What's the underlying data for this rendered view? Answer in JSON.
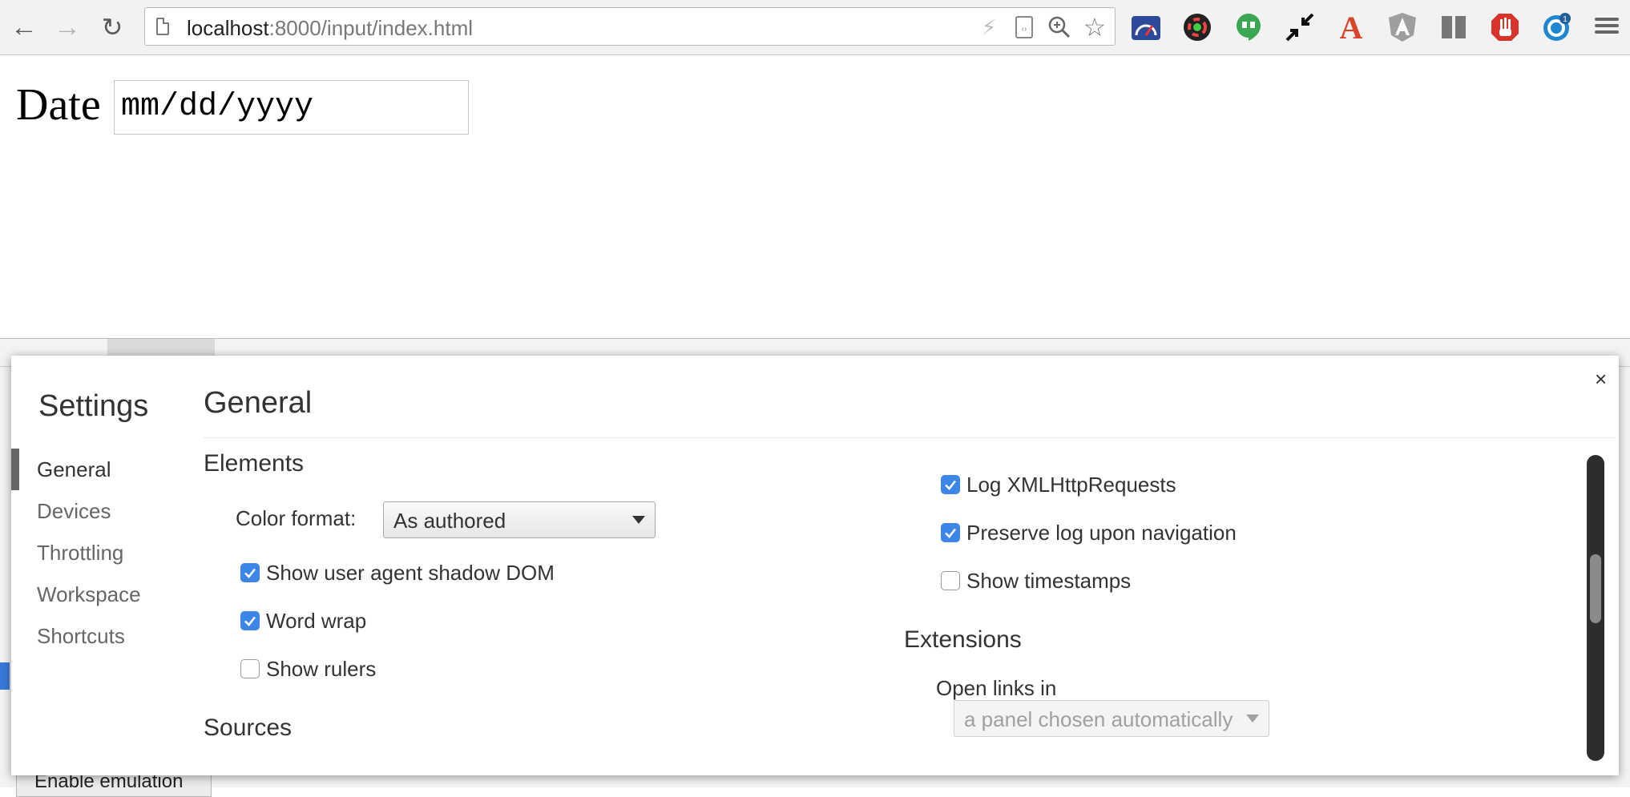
{
  "browser": {
    "url_host": "localhost",
    "url_rest": ":8000/input/index.html"
  },
  "page": {
    "date_label": "Date",
    "date_placeholder": "mm/dd/yyyy"
  },
  "devtools": {
    "bottom_button": "Enable emulation"
  },
  "settings": {
    "title": "Settings",
    "close": "×",
    "nav": [
      {
        "label": "General",
        "active": true
      },
      {
        "label": "Devices",
        "active": false
      },
      {
        "label": "Throttling",
        "active": false
      },
      {
        "label": "Workspace",
        "active": false
      },
      {
        "label": "Shortcuts",
        "active": false
      }
    ],
    "section_title": "General",
    "elements": {
      "title": "Elements",
      "color_format_label": "Color format:",
      "color_format_value": "As authored",
      "options": [
        {
          "label": "Show user agent shadow DOM",
          "checked": true
        },
        {
          "label": "Word wrap",
          "checked": true
        },
        {
          "label": "Show rulers",
          "checked": false
        }
      ]
    },
    "sources": {
      "title": "Sources"
    },
    "console": {
      "options": [
        {
          "label": "Log XMLHttpRequests",
          "checked": true
        },
        {
          "label": "Preserve log upon navigation",
          "checked": true
        },
        {
          "label": "Show timestamps",
          "checked": false
        }
      ]
    },
    "extensions": {
      "title": "Extensions",
      "open_links_label": "Open links in",
      "open_links_value": "a panel chosen automatically"
    }
  },
  "colors": {
    "checkbox_on": "#3b86e6",
    "accent_tab": "#3879d9"
  }
}
